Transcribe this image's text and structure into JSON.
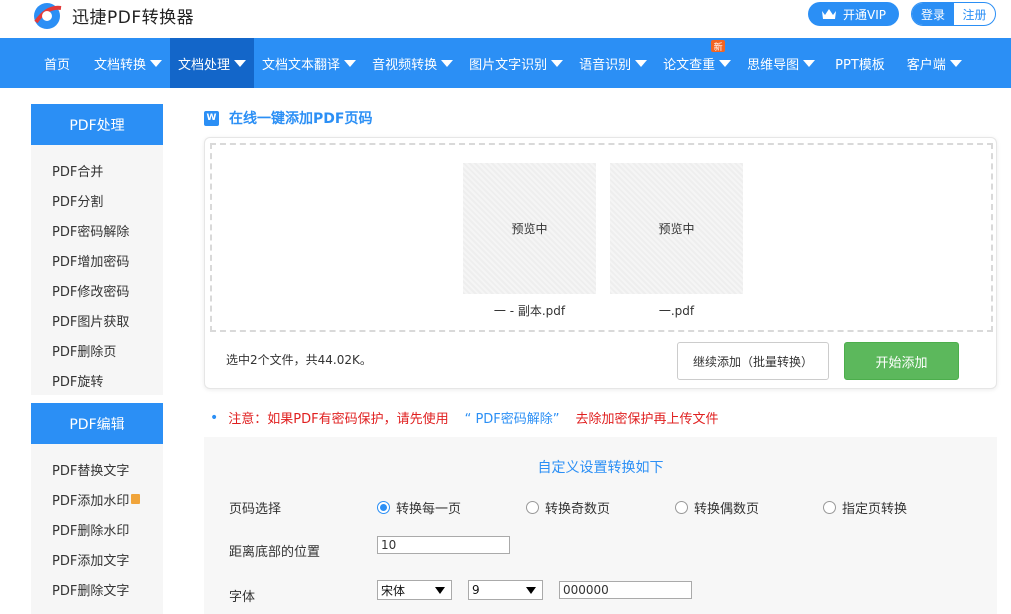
{
  "header": {
    "brand": "迅捷PDF转换器",
    "vip_label": "开通VIP",
    "login": "登录",
    "register": "注册"
  },
  "nav": {
    "items": [
      {
        "label": "首页",
        "caret": false
      },
      {
        "label": "文档转换",
        "caret": true
      },
      {
        "label": "文档处理",
        "caret": true,
        "active": true
      },
      {
        "label": "文档文本翻译",
        "caret": true
      },
      {
        "label": "音视频转换",
        "caret": true
      },
      {
        "label": "图片文字识别",
        "caret": true
      },
      {
        "label": "语音识别",
        "caret": true
      },
      {
        "label": "论文查重",
        "caret": true,
        "badge": "新"
      },
      {
        "label": "思维导图",
        "caret": true
      },
      {
        "label": "PPT模板",
        "caret": false
      },
      {
        "label": "客户端",
        "caret": true
      }
    ]
  },
  "sidebar": {
    "group1_title": "PDF处理",
    "group1_items": [
      "PDF合并",
      "PDF分割",
      "PDF密码解除",
      "PDF增加密码",
      "PDF修改密码",
      "PDF图片获取",
      "PDF删除页",
      "PDF旋转"
    ],
    "group2_title": "PDF编辑",
    "group2_items": [
      "PDF替换文字",
      "PDF添加水印",
      "PDF删除水印",
      "PDF添加文字",
      "PDF删除文字"
    ]
  },
  "main": {
    "title": "在线一键添加PDF页码",
    "title_icon_text": "W",
    "files": [
      {
        "preview": "预览中",
        "name": "一 - 副本.pdf"
      },
      {
        "preview": "预览中",
        "name": "一.pdf"
      }
    ],
    "selection_info": "选中2个文件，共44.02K。",
    "continue_button": "继续添加（批量转换）",
    "start_button": "开始添加"
  },
  "notice": {
    "prefix": "注意：如果PDF有密码保护，请先使用",
    "link": "“ PDF密码解除”",
    "suffix": "去除加密保护再上传文件"
  },
  "settings": {
    "title": "自定义设置转换如下",
    "page_label": "页码选择",
    "radios": [
      {
        "label": "转换每一页",
        "checked": true
      },
      {
        "label": "转换奇数页",
        "checked": false
      },
      {
        "label": "转换偶数页",
        "checked": false
      },
      {
        "label": "指定页转换",
        "checked": false
      }
    ],
    "bottom_label": "距离底部的位置",
    "bottom_value": "10",
    "font_label": "字体",
    "font_value": "宋体",
    "size_value": "9",
    "color_value": "000000"
  },
  "colors": {
    "accent": "#2b8ff5",
    "nav_active": "#1366c9",
    "start_green": "#5cb85c",
    "warning_red": "#e02020"
  }
}
